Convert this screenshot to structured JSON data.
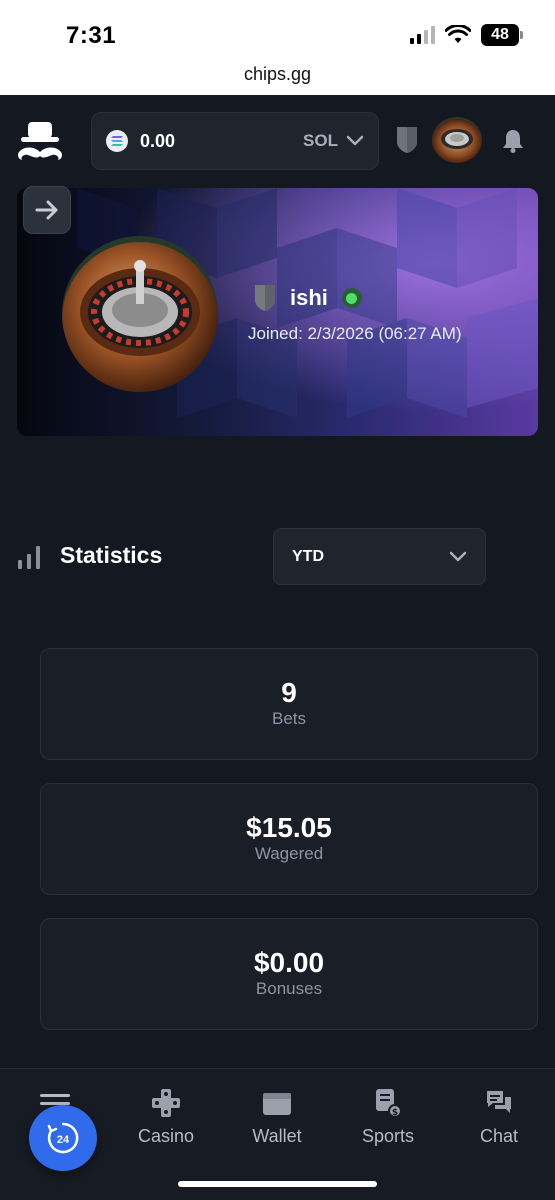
{
  "status_bar": {
    "time": "7:31",
    "battery": "48"
  },
  "browser": {
    "url": "chips.gg"
  },
  "header": {
    "balance": "0.00",
    "currency": "SOL",
    "icons": {
      "logo": "mustache-hat-logo",
      "rank": "shield-icon",
      "notifications": "bell-icon",
      "currency_dropdown": "chevron-down-icon"
    }
  },
  "profile": {
    "username": "ishi",
    "joined": "Joined: 2/3/2026 (06:27 AM)",
    "status": "online",
    "back_icon": "arrow-right-icon"
  },
  "statistics": {
    "title": "Statistics",
    "period": "YTD",
    "cards": [
      {
        "value": "9",
        "label": "Bets"
      },
      {
        "value": "$15.05",
        "label": "Wagered"
      },
      {
        "value": "$0.00",
        "label": "Bonuses"
      }
    ]
  },
  "bottom_nav": {
    "items": [
      {
        "label": "Casino",
        "icon": "gamepad-icon"
      },
      {
        "label": "Wallet",
        "icon": "wallet-icon"
      },
      {
        "label": "Sports",
        "icon": "sports-icon"
      },
      {
        "label": "Chat",
        "icon": "chat-icon"
      }
    ],
    "support_badge": "24"
  },
  "colors": {
    "background": "#141820",
    "card": "#1a1e26",
    "accent_blue": "#2f6bea",
    "online_green": "#4be06a"
  }
}
